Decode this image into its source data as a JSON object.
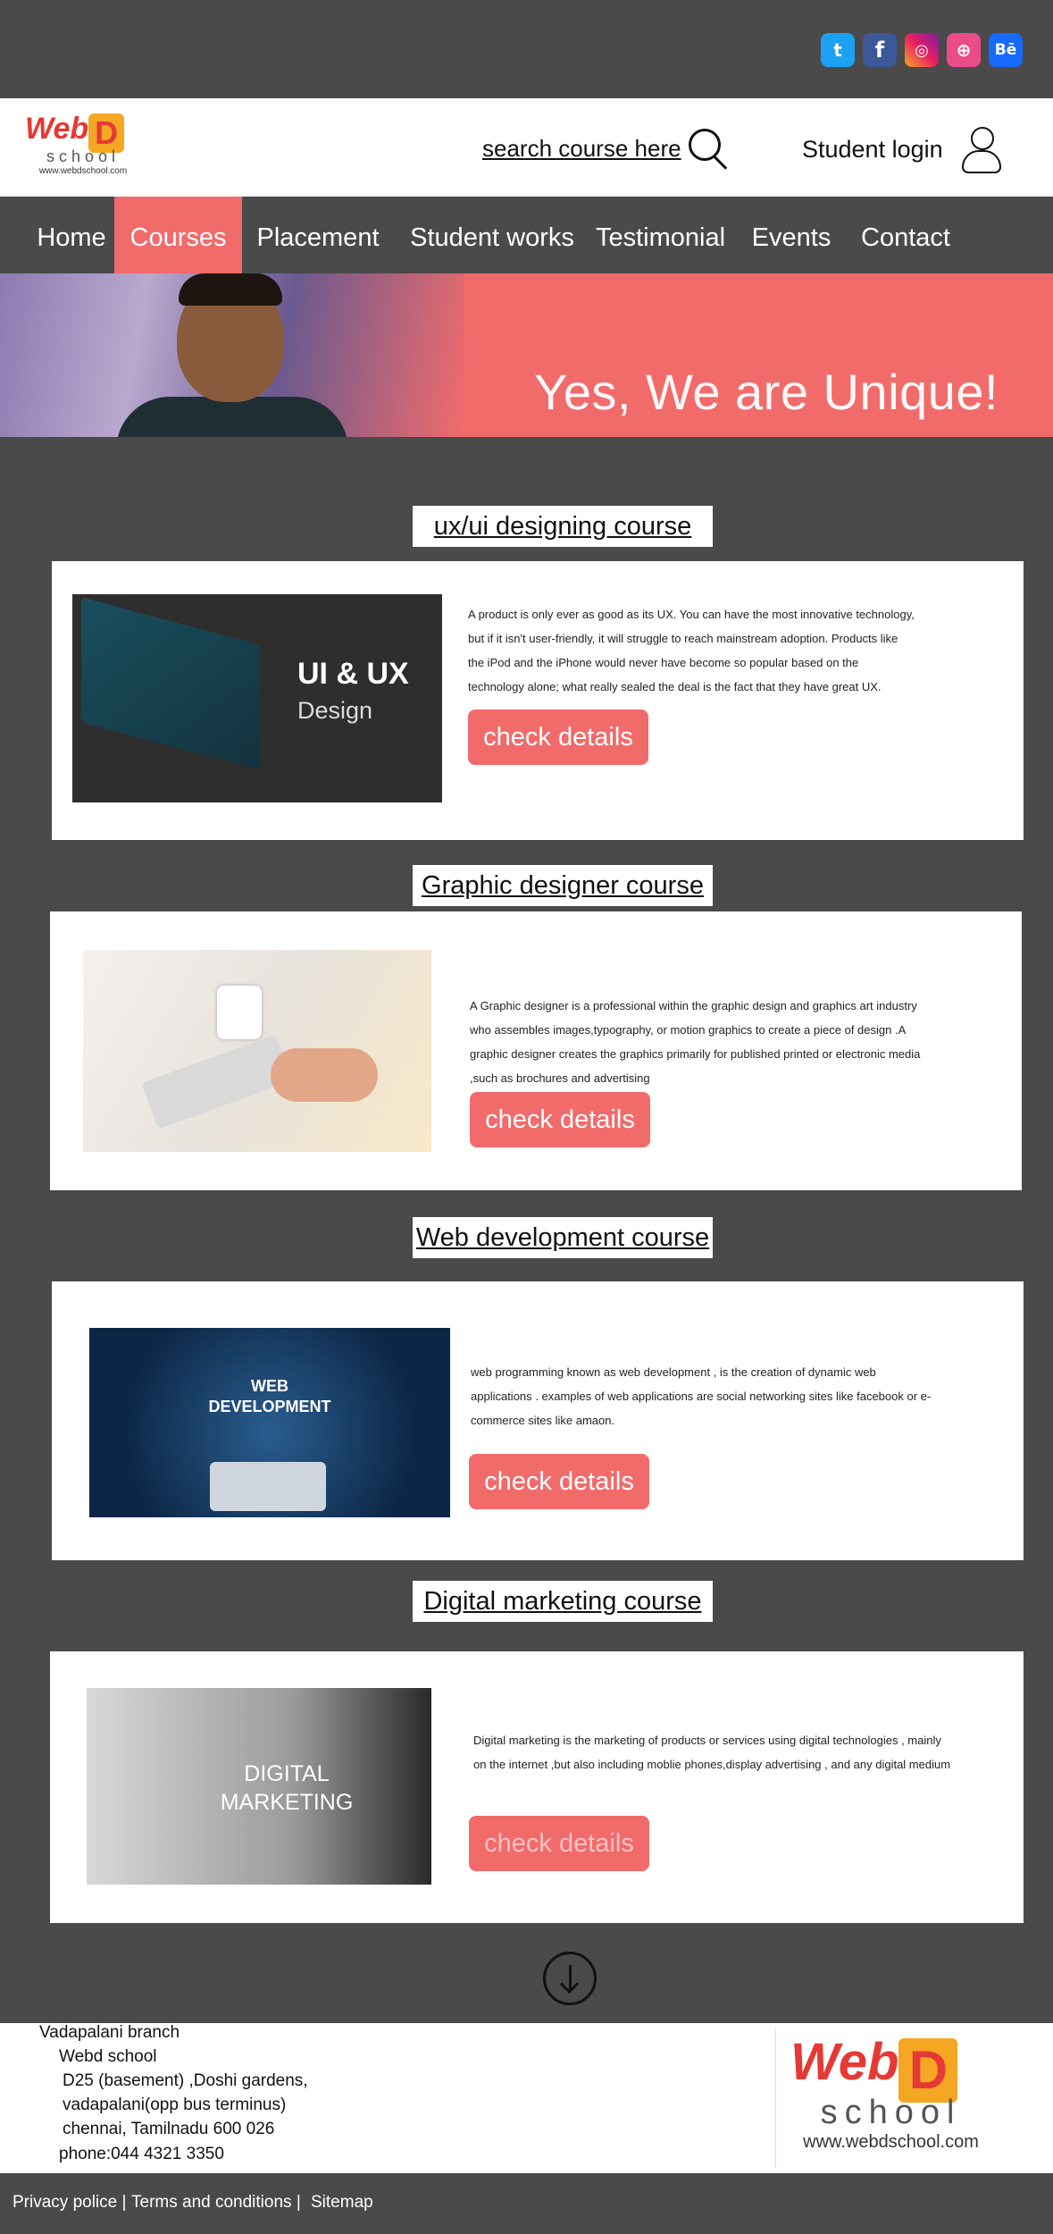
{
  "social": {
    "twitter": "t",
    "facebook": "f",
    "instagram": "◎",
    "dribbble": "⊕",
    "behance": "Bē"
  },
  "brand": {
    "logo_web": "Web",
    "logo_d": "D",
    "logo_school": "school",
    "logo_url": "www.webdschool.com"
  },
  "header": {
    "search_label": "search course here",
    "login_label": "Student login"
  },
  "nav": {
    "items": [
      "Home",
      "Courses",
      "Placement",
      "Student works",
      "Testimonial",
      "Events",
      "Contact"
    ],
    "active": "Courses"
  },
  "hero": {
    "tagline": "Yes, We are Unique!"
  },
  "courses": [
    {
      "title": "ux/ui  designing course",
      "image_line1": "UI & UX",
      "image_line2": "Design",
      "description": "A product is only ever as good as its UX. You can have the most innovative technology, but if it isn't user-friendly, it will struggle to reach mainstream adoption. Products like the iPod and the iPhone would never have become so popular based on the technology alone; what really sealed the deal is the fact that they have great UX.",
      "button": "check details"
    },
    {
      "title": "Graphic designer course",
      "description": "A Graphic designer is a professional within the graphic design and graphics  art industry  who assembles images,typography, or motion graphics to create  a piece  of design .A graphic designer creates  the  graphics primarily  for published printed or electronic media ,such as  brochures and advertising",
      "button": "check details"
    },
    {
      "title": "Web development course",
      "image_line1": "WEB",
      "image_line2": "DEVELOPMENT",
      "description": "web programming known as web development , is the creation of dynamic web applications . examples of web applications are social  networking sites like facebook or e-commerce sites like amaon.",
      "button": "check details"
    },
    {
      "title": "Digital marketing course",
      "image_line1": "DIGITAL",
      "image_line2": "MARKETING",
      "description": "Digital marketing  is the marketing of products or services using digital technologies , mainly on the internet ,but also  including moblie phones,display advertising , and any digital medium",
      "button": "check details"
    }
  ],
  "footer": {
    "address": [
      "Vadapalani branch",
      "Webd school",
      "D25 (basement) ,Doshi gardens,",
      "vadapalani(opp bus terminus)",
      "chennai, Tamilnadu 600 026",
      "phone:044 4321 3350"
    ],
    "links": [
      "Privacy police |",
      "Terms and conditions |",
      "Sitemap"
    ]
  },
  "colors": {
    "accent": "#f26b6b",
    "dark": "#4a4a4a",
    "logo_red": "#e53935",
    "logo_orange": "#f5a623"
  }
}
